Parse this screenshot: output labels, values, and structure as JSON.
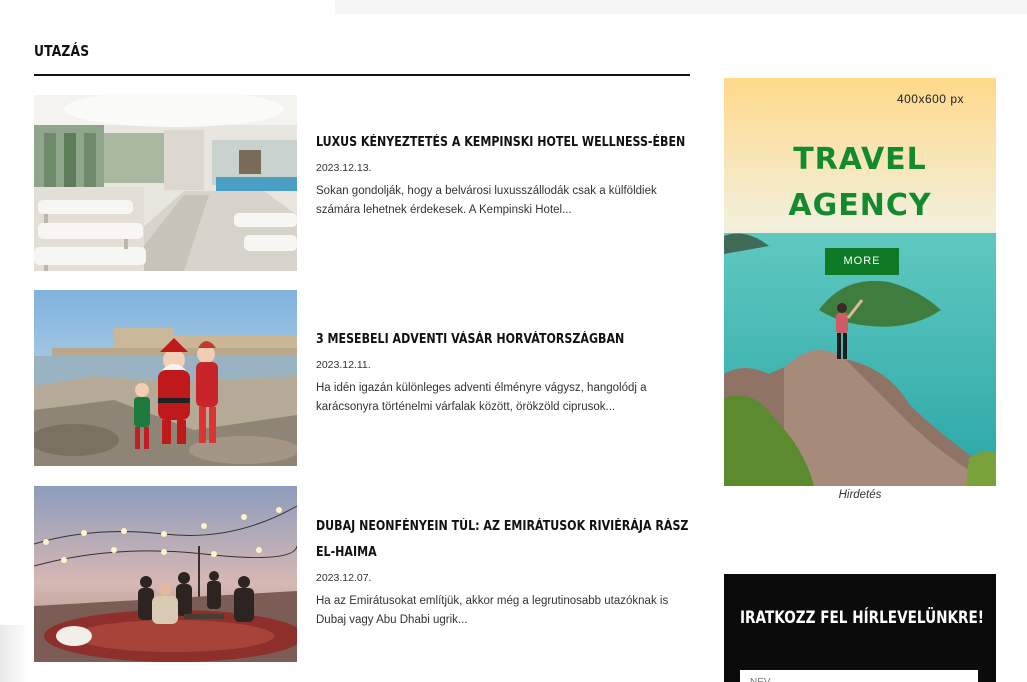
{
  "section": {
    "title": "UTAZÁS"
  },
  "articles": [
    {
      "title": "LUXUS KÉNYEZTETÉS A KEMPINSKI HOTEL WELLNESS-ÉBEN",
      "date": "2023.12.13.",
      "excerpt": "Sokan gondolják, hogy a belvárosi luxusszállodák csak a külföldiek számára lehetnek érdekesek. A Kempinski Hotel..."
    },
    {
      "title": "3 MESEBELI ADVENTI VÁSÁR HORVÁTORSZÁGBAN",
      "date": "2023.12.11.",
      "excerpt": "Ha idén igazán különleges adventi élményre vágysz, hangolódj a karácsonyra történelmi várfalak között, örökzöld ciprusok..."
    },
    {
      "title": "DUBAJ NEONFÉNYEIN TÚL: AZ EMIRÁTUSOK RIVIÉRÁJA RÁSZ EL-HAIMA",
      "date": "2023.12.07.",
      "excerpt": "Ha az Emirátusokat említjük, akkor még a legrutinosabb utazóknak is Dubaj vagy Abu Dhabi ugrik..."
    }
  ],
  "ad": {
    "size_label": "400x600 px",
    "title_line1": "TRAVEL",
    "title_line2": "AGENCY",
    "button_label": "MORE",
    "caption": "Hirdetés",
    "accent_color": "#128a2d"
  },
  "newsletter": {
    "title": "IRATKOZZ FEL HÍRLEVELÜNKRE!",
    "input_placeholder": "NÉV"
  }
}
